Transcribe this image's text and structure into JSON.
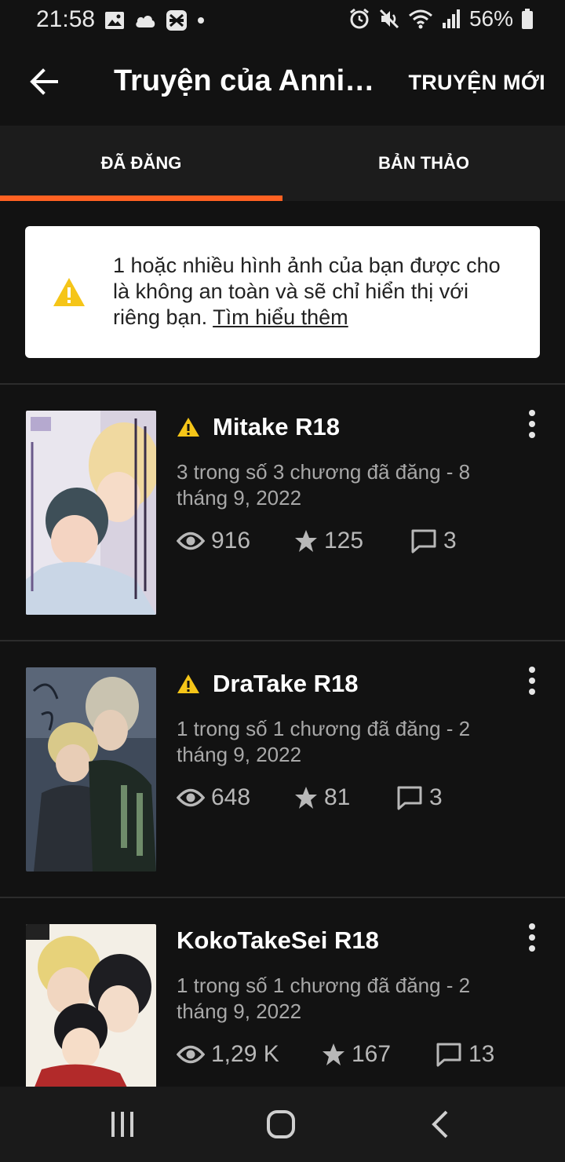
{
  "status_bar": {
    "time": "21:58",
    "battery": "56%",
    "left_icons": [
      "image-icon",
      "cloud-icon",
      "app-icon",
      "dot-icon"
    ],
    "right_icons": [
      "alarm-icon",
      "mute-icon",
      "wifi-icon",
      "signal-icon",
      "battery-icon"
    ]
  },
  "app_bar": {
    "title": "Truyện của Annie...",
    "new_story_label": "TRUYỆN MỚI"
  },
  "tabs": [
    {
      "label": "ĐÃ ĐĂNG",
      "active": true
    },
    {
      "label": "BẢN THẢO",
      "active": false
    }
  ],
  "warning": {
    "text": "1 hoặc nhiều hình ảnh của bạn được cho là không an toàn và sẽ chỉ hiển thị với riêng bạn.",
    "link": "Tìm hiểu thêm"
  },
  "stories": [
    {
      "title": "Mitake R18",
      "warning": true,
      "meta": "3 trong số 3 chương đã đăng - 8 tháng 9, 2022",
      "views": "916",
      "stars": "125",
      "comments": "3"
    },
    {
      "title": "DraTake R18",
      "warning": true,
      "meta": "1 trong số 1 chương đã đăng - 2 tháng 9, 2022",
      "views": "648",
      "stars": "81",
      "comments": "3"
    },
    {
      "title": "KokoTakeSei R18",
      "warning": false,
      "meta": "1 trong số 1 chương đã đăng - 2 tháng 9, 2022",
      "views": "1,29 K",
      "stars": "167",
      "comments": "13"
    }
  ],
  "colors": {
    "accent": "#ff6122",
    "warning_yellow": "#f5c518",
    "background": "#121212"
  }
}
